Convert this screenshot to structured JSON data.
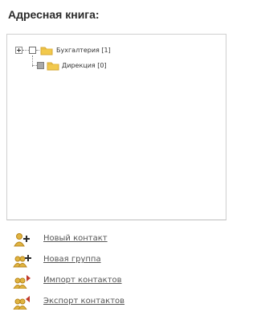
{
  "title": "Адресная книга:",
  "tree": {
    "items": [
      {
        "label": "Бухгалтерия [1]",
        "expandable": true
      },
      {
        "label": "Дирекция [0]",
        "expandable": false
      }
    ]
  },
  "actions": [
    {
      "label": "Новый контакт",
      "icon": "add-contact-icon"
    },
    {
      "label": "Новая группа",
      "icon": "add-group-icon"
    },
    {
      "label": "Импорт контактов",
      "icon": "import-contacts-icon"
    },
    {
      "label": "Экспорт контактов",
      "icon": "export-contacts-icon"
    }
  ],
  "colors": {
    "folder": "#f2c94c",
    "folder_dark": "#d6a733",
    "link": "#555555",
    "accent_red": "#c0392b"
  }
}
